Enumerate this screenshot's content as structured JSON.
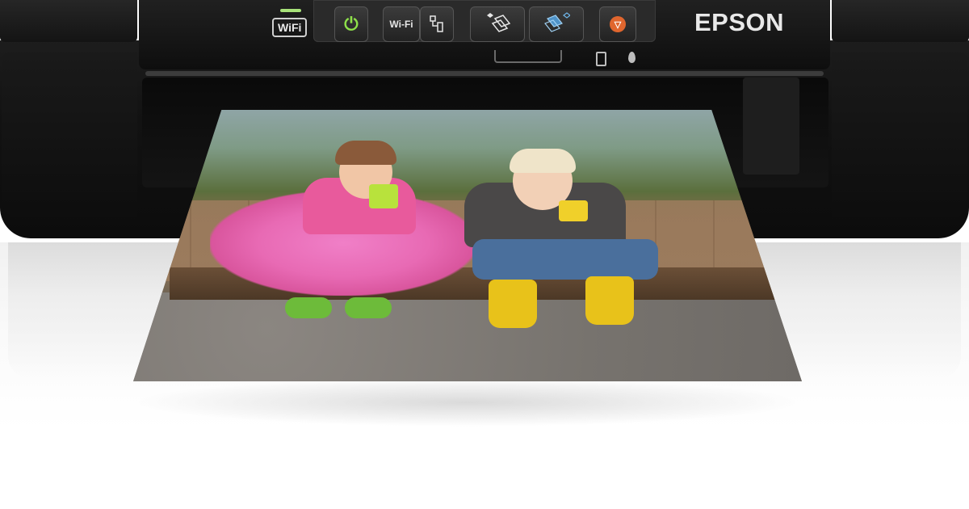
{
  "brand": {
    "name": "EPSON"
  },
  "control_panel": {
    "wifi_logo": "WiFi",
    "buttons": [
      {
        "name": "power",
        "label": "",
        "icon": "power-icon"
      },
      {
        "name": "wifi",
        "label": "Wi-Fi",
        "icon": ""
      },
      {
        "name": "wps",
        "label": "",
        "icon": "network-icon"
      },
      {
        "name": "copy-bw",
        "label": "",
        "icon": "copy-bw-icon"
      },
      {
        "name": "copy-color",
        "label": "",
        "icon": "copy-color-icon"
      },
      {
        "name": "stop",
        "label": "",
        "icon": "stop-icon"
      }
    ],
    "indicators": [
      "paper-icon",
      "ink-icon"
    ]
  },
  "colors": {
    "power_led": "#8ee04a",
    "stop_button": "#e0662e",
    "printer_body": "#121212"
  },
  "printed_photo": {
    "subject": ""
  }
}
